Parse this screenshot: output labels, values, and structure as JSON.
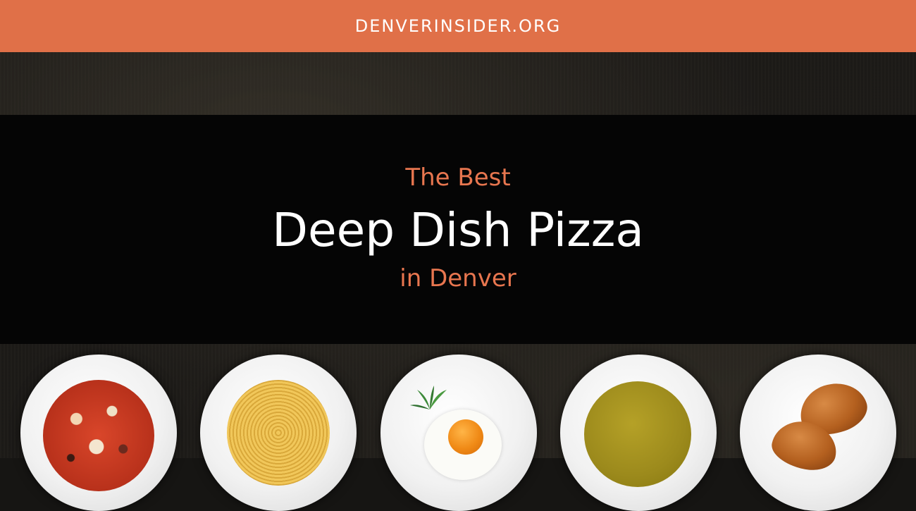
{
  "header": {
    "site_name": "DENVERINSIDER.ORG"
  },
  "hero": {
    "line_top": "The Best",
    "line_main": "Deep Dish Pizza",
    "line_bottom": "in Denver"
  },
  "colors": {
    "accent": "#e07048",
    "accent_text": "#e8764f",
    "band": "#050505",
    "headline": "#ffffff"
  },
  "plates": [
    {
      "name": "minestrone-soup-plate"
    },
    {
      "name": "spaghetti-plate"
    },
    {
      "name": "fried-egg-plate"
    },
    {
      "name": "cream-soup-plate"
    },
    {
      "name": "croissant-plate"
    }
  ]
}
